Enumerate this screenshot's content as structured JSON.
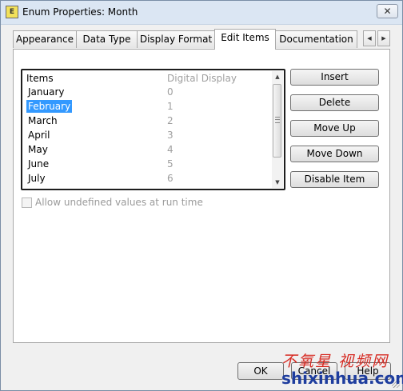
{
  "window": {
    "title": "Enum Properties: Month",
    "app_icon": "enum-icon",
    "close_label": "✕"
  },
  "tabs": [
    {
      "label": "Appearance",
      "active": false
    },
    {
      "label": "Data Type",
      "active": false
    },
    {
      "label": "Display Format",
      "active": false
    },
    {
      "label": "Edit Items",
      "active": true
    },
    {
      "label": "Documentation",
      "active": false
    }
  ],
  "tab_scroll": {
    "left": "◀",
    "right": "▶"
  },
  "items_list": {
    "headers": {
      "items": "Items",
      "digital_display": "Digital Display"
    },
    "rows": [
      {
        "label": "January",
        "value": "0"
      },
      {
        "label": "February",
        "value": "1",
        "selected": true
      },
      {
        "label": "March",
        "value": "2"
      },
      {
        "label": "April",
        "value": "3"
      },
      {
        "label": "May",
        "value": "4"
      },
      {
        "label": "June",
        "value": "5"
      },
      {
        "label": "July",
        "value": "6"
      }
    ],
    "scroll_up": "▲",
    "scroll_down": "▼"
  },
  "actions": {
    "insert": "Insert",
    "delete": "Delete",
    "move_up": "Move Up",
    "move_down": "Move Down",
    "disable_item": "Disable Item"
  },
  "undefined_values": {
    "label": "Allow undefined values at run time",
    "checked": false,
    "enabled": false
  },
  "footer": {
    "ok": "OK",
    "cancel": "Cancel",
    "help": "Help"
  },
  "watermark": {
    "top": "不氧星 视频网",
    "bottom": "shixinhua.com"
  },
  "colors": {
    "selection": "#3399ff",
    "disabled_text": "#a0a0a0",
    "title_bar": "#dbe6f3"
  }
}
